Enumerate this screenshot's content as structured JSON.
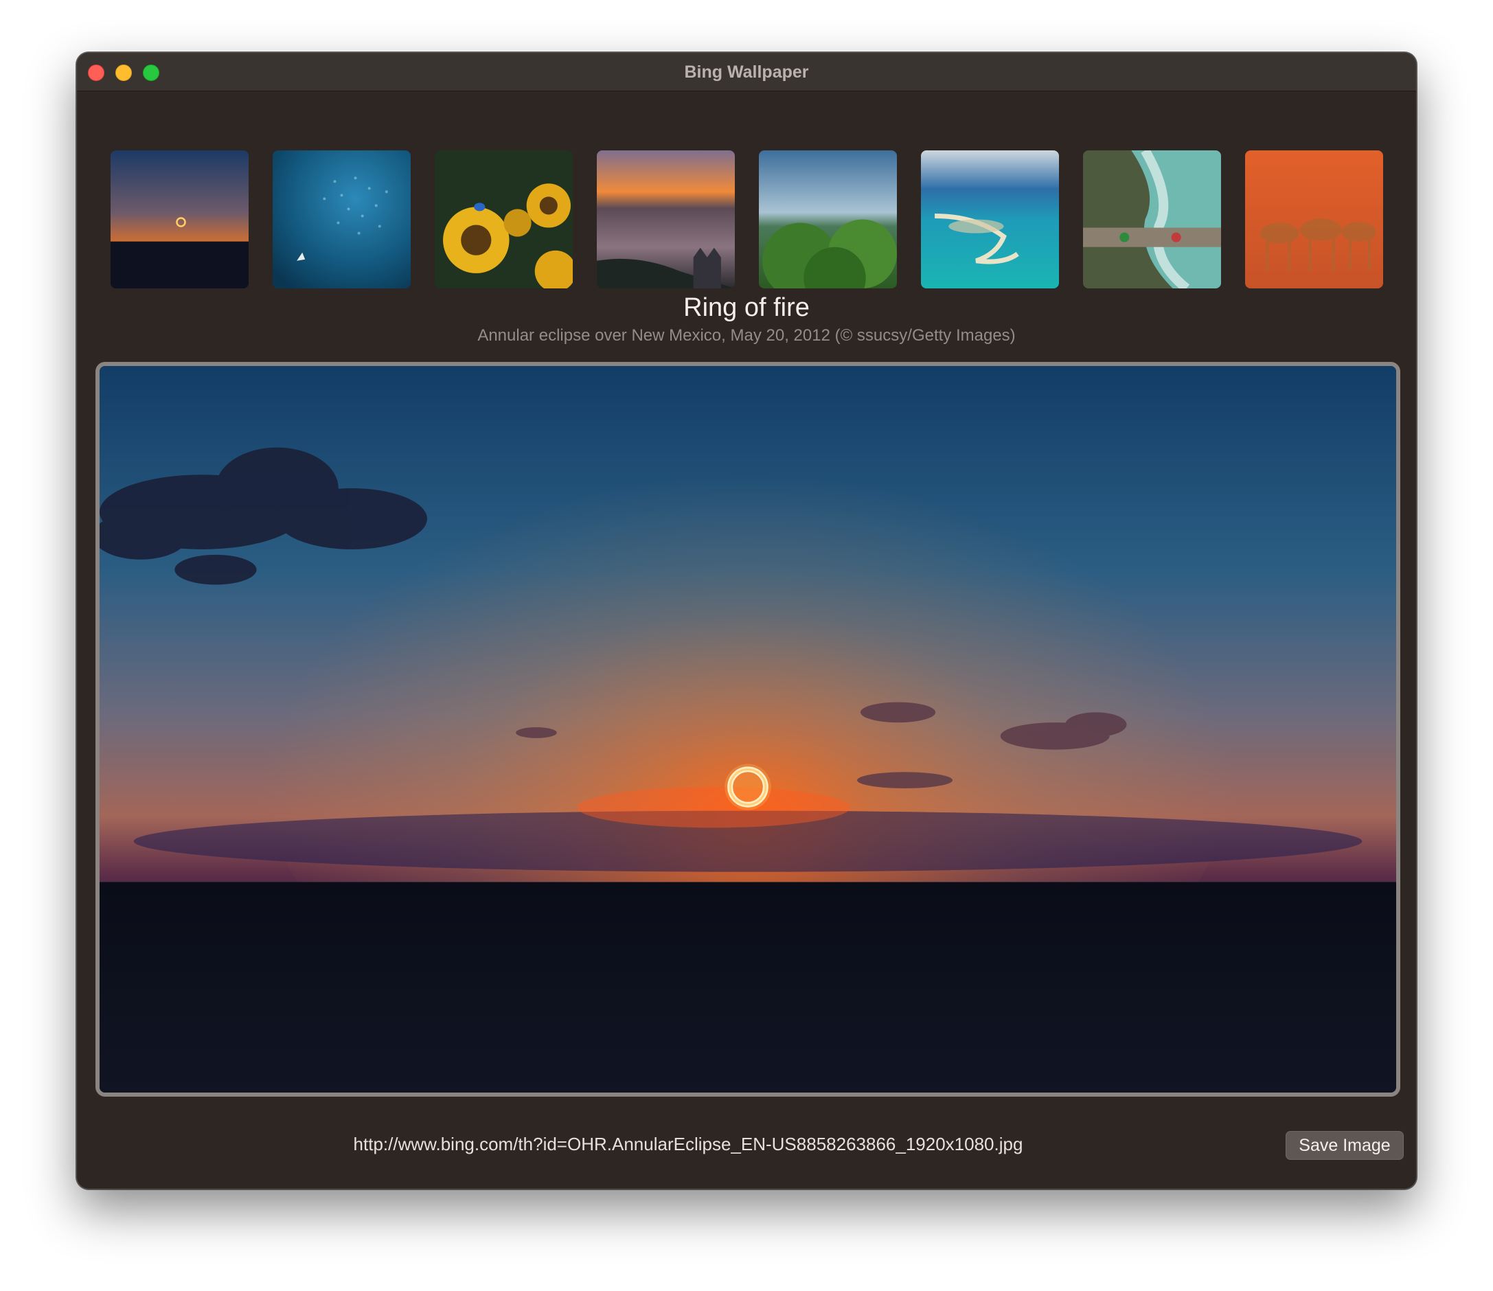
{
  "window": {
    "title": "Bing Wallpaper"
  },
  "thumbnails": [
    {
      "subject": "eclipse-sunset"
    },
    {
      "subject": "underwater-fish"
    },
    {
      "subject": "sunflowers-bird"
    },
    {
      "subject": "coast-sunset"
    },
    {
      "subject": "forest-sky"
    },
    {
      "subject": "tropical-island"
    },
    {
      "subject": "river-bridge"
    },
    {
      "subject": "antelopes-dust"
    }
  ],
  "wallpaper": {
    "title": "Ring of fire",
    "description": "Annular eclipse over New Mexico, May 20, 2012 (© ssucsy/Getty Images)",
    "url": "http://www.bing.com/th?id=OHR.AnnularEclipse_EN-US8858263866_1920x1080.jpg"
  },
  "actions": {
    "save_label": "Save Image"
  }
}
